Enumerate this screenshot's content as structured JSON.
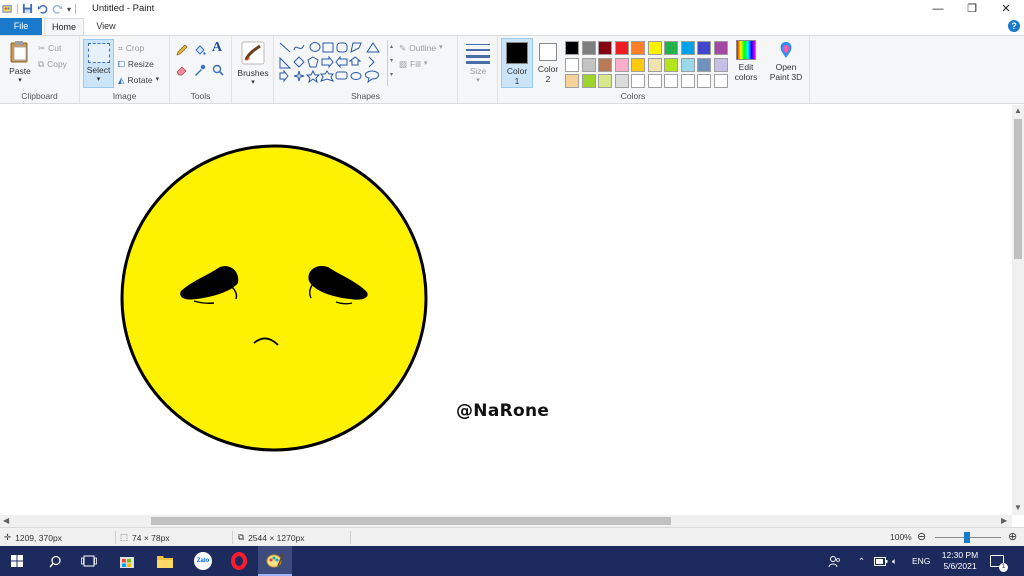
{
  "window": {
    "title": "Untitled - Paint",
    "minimize_glyph": "—",
    "restore_glyph": "❐",
    "close_glyph": "✕"
  },
  "tabs": {
    "file": "File",
    "home": "Home",
    "view": "View"
  },
  "help_glyph": "?",
  "ribbon": {
    "clipboard": {
      "label": "Clipboard",
      "paste": "Paste",
      "cut": "Cut",
      "copy": "Copy"
    },
    "image": {
      "label": "Image",
      "select": "Select",
      "crop": "Crop",
      "resize": "Resize",
      "rotate": "Rotate"
    },
    "tools": {
      "label": "Tools"
    },
    "brushes": {
      "label": "Brushes"
    },
    "shapes": {
      "label": "Shapes",
      "outline": "Outline",
      "fill": "Fill"
    },
    "size": {
      "label": "Size"
    },
    "colors": {
      "label": "Colors",
      "color1": "Color",
      "color1_num": "1",
      "color2": "Color",
      "color2_num": "2",
      "edit_colors": [
        "Edit",
        "colors"
      ],
      "open_paint3d": [
        "Open",
        "Paint 3D"
      ],
      "color1_value": "#000000",
      "color2_value": "#ffffff",
      "palette_row1": [
        "#000000",
        "#7f7f7f",
        "#880015",
        "#ed1c24",
        "#ff7f27",
        "#fff200",
        "#22b14c",
        "#00a2e8",
        "#3f48cc",
        "#a349a4"
      ],
      "palette_row2": [
        "#ffffff",
        "#c3c3c3",
        "#b97a57",
        "#ffaec9",
        "#ffc90e",
        "#efe4b0",
        "#b5e61d",
        "#99d9ea",
        "#7092be",
        "#c8bfe7"
      ],
      "palette_row3": [
        "#f5d29a",
        "#9fd32e",
        "#d6e88a",
        "#dcdcdc",
        "#ffffff",
        "#ffffff",
        "#ffffff",
        "#ffffff",
        "#ffffff",
        "#ffffff"
      ]
    }
  },
  "canvas": {
    "signature": "@NaRone",
    "face_color": "#fff200"
  },
  "status": {
    "cursor": "1209, 370px",
    "selection": "74 × 78px",
    "image_size": "2544 × 1270px",
    "zoom": "100%"
  },
  "taskbar": {
    "apps": [
      "start-icon",
      "search-icon",
      "task-view-icon",
      "store-icon",
      "file-explorer-icon",
      "zalo-icon",
      "opera-icon",
      "paint-icon"
    ],
    "zalo_label": "Zalo",
    "language": "ENG",
    "time": "12:30 PM",
    "date": "5/6/2021",
    "notification_count": "1"
  }
}
